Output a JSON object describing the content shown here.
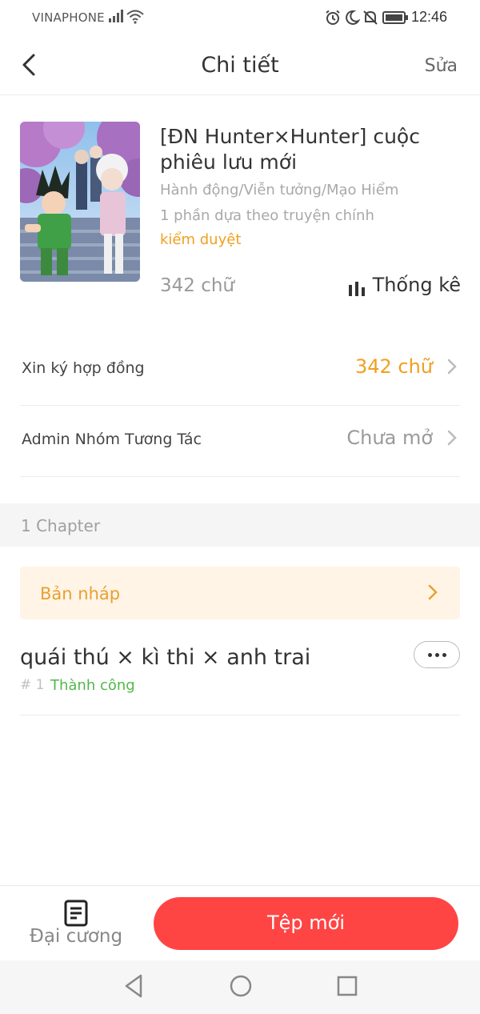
{
  "status_bar": {
    "carrier": "VINAPHONE",
    "time": "12:46",
    "icons": [
      "signal-icon",
      "wifi-icon",
      "alarm-icon",
      "moon-icon",
      "mute-icon",
      "battery-icon"
    ]
  },
  "header": {
    "title": "Chi tiết",
    "edit_label": "Sửa",
    "back_icon": "chevron-left-icon"
  },
  "book": {
    "title": "[ĐN Hunter×Hunter] cuộc phiêu lưu mới",
    "genre": "Hành động/Viễn tưởng/Mạo Hiểm",
    "description": "1 phần dựa theo truyện chính",
    "status": "kiểm duyệt",
    "word_count": "342 chữ",
    "stats_label": "Thống kê"
  },
  "rows": [
    {
      "label": "Xin ký hợp đồng",
      "value": "342 chữ",
      "value_color": "#f0a020"
    },
    {
      "label": "Admin Nhóm Tương Tác",
      "value": "Chưa mở",
      "value_color": "#9a9a9a"
    }
  ],
  "chapters_section": {
    "count_label": "1 Chapter",
    "draft_label": "Bản nháp",
    "items": [
      {
        "title": "quái thú × kì thi × anh trai",
        "number": "# 1",
        "state": "Thành công"
      }
    ]
  },
  "bottom_bar": {
    "outline_label": "Đại cương",
    "new_file_label": "Tệp mới"
  },
  "colors": {
    "accent_orange": "#f0a020",
    "primary_red": "#ff4444",
    "success_green": "#52b84a"
  }
}
